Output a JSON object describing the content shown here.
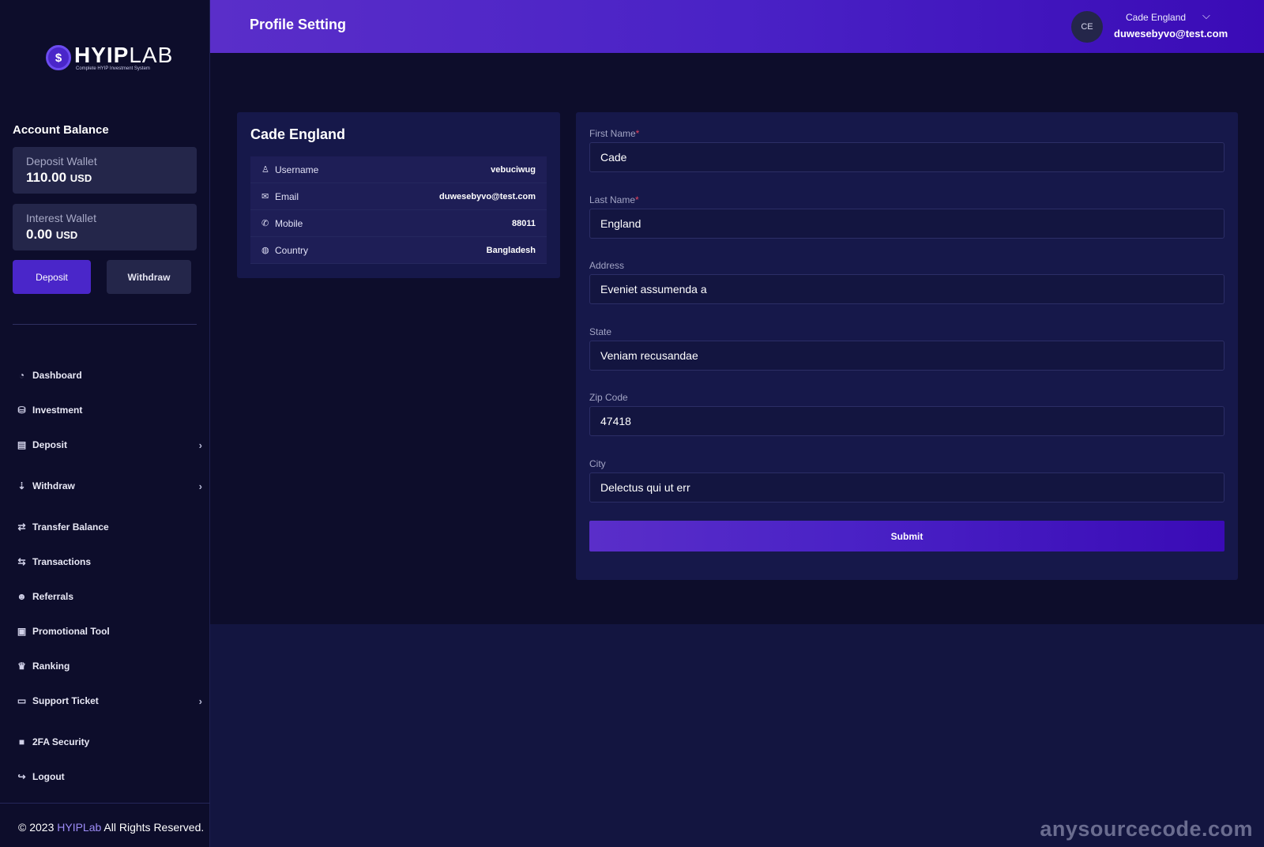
{
  "logo": {
    "mark": "$",
    "title_bold": "HYIP",
    "title_light": "LAB",
    "subtitle": "Complete HYIP Investment System"
  },
  "sidebar": {
    "account_title": "Account Balance",
    "wallets": [
      {
        "label": "Deposit Wallet",
        "amount": "110.00",
        "currency": "USD"
      },
      {
        "label": "Interest Wallet",
        "amount": "0.00",
        "currency": "USD"
      }
    ],
    "deposit_button": "Deposit",
    "withdraw_button": "Withdraw",
    "nav": [
      {
        "label": "Dashboard",
        "icon": "dashboard-icon",
        "glyph": "◔"
      },
      {
        "label": "Investment",
        "icon": "investment-icon",
        "glyph": "⛁"
      },
      {
        "label": "Deposit",
        "icon": "deposit-icon",
        "glyph": "▤",
        "chevron": "›"
      },
      {
        "label": "Withdraw",
        "icon": "withdraw-icon",
        "glyph": "⇣",
        "chevron": "›"
      },
      {
        "label": "Transfer Balance",
        "icon": "handshake-icon",
        "glyph": "⇄"
      },
      {
        "label": "Transactions",
        "icon": "exchange-icon",
        "glyph": "⇆"
      },
      {
        "label": "Referrals",
        "icon": "users-icon",
        "glyph": "☻"
      },
      {
        "label": "Promotional Tool",
        "icon": "ad-icon",
        "glyph": "▣"
      },
      {
        "label": "Ranking",
        "icon": "crown-icon",
        "glyph": "♛"
      },
      {
        "label": "Support Ticket",
        "icon": "ticket-icon",
        "glyph": "▭",
        "chevron": "›"
      },
      {
        "label": "2FA Security",
        "icon": "lock-icon",
        "glyph": "■"
      },
      {
        "label": "Logout",
        "icon": "logout-icon",
        "glyph": "↪"
      }
    ],
    "copyright_prefix": "© 2023",
    "copyright_brand": "HYIPLab",
    "copyright_suffix": "All Rights Reserved."
  },
  "header": {
    "title": "Profile Setting",
    "avatar_initials": "CE",
    "user_name": "Cade England",
    "user_email": "duwesebyvo@test.com",
    "chevron": "⌵"
  },
  "profile": {
    "name": "Cade England",
    "rows": [
      {
        "label": "Username",
        "value": "vebuciwug",
        "icon": "user-icon",
        "glyph": "♙"
      },
      {
        "label": "Email",
        "value": "duwesebyvo@test.com",
        "icon": "envelope-icon",
        "glyph": "✉"
      },
      {
        "label": "Mobile",
        "value": "88011",
        "icon": "phone-icon",
        "glyph": "✆"
      },
      {
        "label": "Country",
        "value": "Bangladesh",
        "icon": "globe-icon",
        "glyph": "◍"
      }
    ]
  },
  "form": {
    "fields": [
      {
        "label": "First Name",
        "required": "*",
        "value": "Cade"
      },
      {
        "label": "Last Name",
        "required": "*",
        "value": "England"
      },
      {
        "label": "Address",
        "required": "",
        "value": "Eveniet assumenda a"
      },
      {
        "label": "State",
        "required": "",
        "value": "Veniam recusandae"
      },
      {
        "label": "Zip Code",
        "required": "",
        "value": "47418"
      },
      {
        "label": "City",
        "required": "",
        "value": "Delectus qui ut err"
      }
    ],
    "submit": "Submit"
  },
  "watermark": "anysourcecode.com",
  "colors": {
    "accent": "#4a26c9",
    "sidebar_bg": "#0d0d2b",
    "card_bg": "#16184a",
    "required": "#e6455f"
  }
}
